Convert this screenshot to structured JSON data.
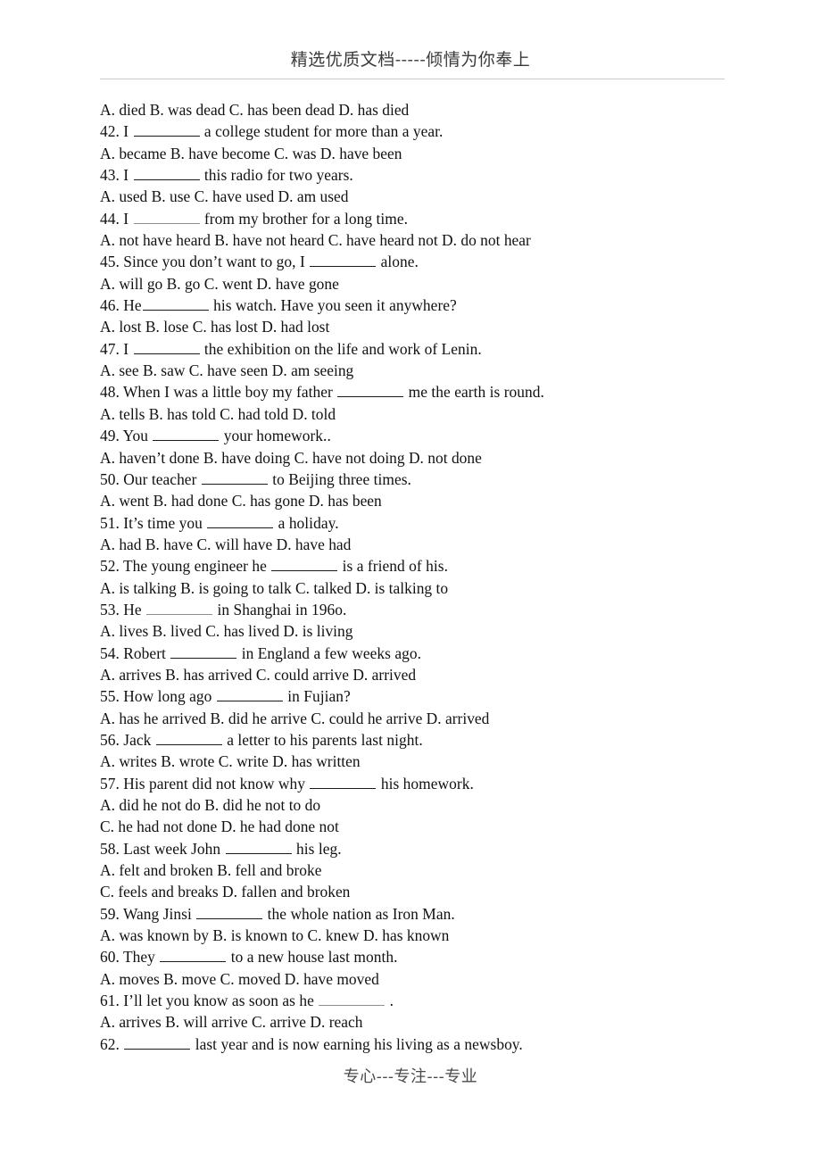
{
  "header": {
    "title": "精选优质文档-----倾情为你奉上",
    "rule_color": "#c9c9c9"
  },
  "footer": {
    "title": "专心---专注---专业"
  },
  "document": {
    "kind": "english-grammar-multiple-choice-worksheet",
    "page_text_color": "#111111",
    "lines": [
      {
        "id": "q41-options",
        "kind": "options",
        "text": "A. died    B. was dead    C. has been dead    D. has died"
      },
      {
        "id": "q42-stem",
        "kind": "stem",
        "pre": "42. I ",
        "post": " a college student for more than a year.",
        "blank": "w-std"
      },
      {
        "id": "q42-options",
        "kind": "options",
        "text": "A. became    B. have become    C. was    D. have been"
      },
      {
        "id": "q43-stem",
        "kind": "stem",
        "pre": "43. I ",
        "post": " this radio for two years.",
        "blank": "w-std"
      },
      {
        "id": "q43-options",
        "kind": "options",
        "text": "A. used   B. use   C. have used   D. am used"
      },
      {
        "id": "q44-stem",
        "kind": "stem",
        "pre": "44. I ",
        "post": " from my brother for a long time.",
        "blank": "w-faint"
      },
      {
        "id": "q44-options",
        "kind": "options",
        "text": "A. not have heard    B. have not heard    C. have heard not    D. do not hear"
      },
      {
        "id": "q45-stem",
        "kind": "stem",
        "pre": "45. Since you don’t want to go, I ",
        "post": " alone.",
        "blank": "w-std"
      },
      {
        "id": "q45-options",
        "kind": "options",
        "text": "A. will go   B. go   C. went   D. have gone"
      },
      {
        "id": "q46-stem",
        "kind": "stem",
        "pre": "46. He",
        "post": " his watch. Have you seen it anywhere?",
        "blank": "w-std"
      },
      {
        "id": "q46-options",
        "kind": "options",
        "text": "A. lost   B. lose   C. has lost   D. had lost"
      },
      {
        "id": "q47-stem",
        "kind": "stem",
        "pre": "47. I ",
        "post": " the exhibition on the life and work of Lenin.",
        "blank": "w-std"
      },
      {
        "id": "q47-options",
        "kind": "options",
        "text": "A. see   B. saw   C. have seen   D. am seeing"
      },
      {
        "id": "q48-stem",
        "kind": "stem",
        "pre": "48. When I was a little boy my father ",
        "post": " me the earth is round.",
        "blank": "w-std"
      },
      {
        "id": "q48-options",
        "kind": "options",
        "text": "A. tells   B. has told   C. had told   D. told"
      },
      {
        "id": "q49-stem",
        "kind": "stem",
        "pre": "49. You ",
        "post": " your homework..",
        "blank": "w-std"
      },
      {
        "id": "q49-options",
        "kind": "options",
        "text": "A. haven’t done   B. have doing   C. have not doing   D. not done"
      },
      {
        "id": "q50-stem",
        "kind": "stem",
        "pre": "50. Our teacher ",
        "post": " to Beijing three times.",
        "blank": "w-std"
      },
      {
        "id": "q50-options",
        "kind": "options",
        "text": "A. went   B. had done   C. has gone   D. has been"
      },
      {
        "id": "q51-stem",
        "kind": "stem",
        "pre": "51. It’s time you ",
        "post": " a holiday.",
        "blank": "w-std"
      },
      {
        "id": "q51-options",
        "kind": "options",
        "text": "A. had    B. have    C. will have    D. have had"
      },
      {
        "id": "q52-stem",
        "kind": "stem",
        "pre": "52. The young engineer he ",
        "post": " is a friend of his.",
        "blank": "w-std"
      },
      {
        "id": "q52-options",
        "kind": "options",
        "text": "A. is talking    B. is going to talk    C. talked    D. is talking to"
      },
      {
        "id": "q53-stem",
        "kind": "stem",
        "pre": "53. He ",
        "post": " in Shanghai in 196o.",
        "blank": "w-faint"
      },
      {
        "id": "q53-options",
        "kind": "options",
        "text": "A. lives   B. lived   C. has lived   D. is living"
      },
      {
        "id": "q54-stem",
        "kind": "stem",
        "pre": "54. Robert ",
        "post": " in England a few weeks ago.",
        "blank": "w-std"
      },
      {
        "id": "q54-options",
        "kind": "options",
        "text": "A. arrives    B. has arrived    C. could arrive    D. arrived"
      },
      {
        "id": "q55-stem",
        "kind": "stem",
        "pre": "55. How long ago ",
        "post": " in Fujian?",
        "blank": "w-std"
      },
      {
        "id": "q55-options",
        "kind": "options",
        "text": "A. has he arrived    B. did he arrive    C. could he arrive    D. arrived"
      },
      {
        "id": "q56-stem",
        "kind": "stem",
        "pre": "56. Jack ",
        "post": " a letter to his parents last night.",
        "blank": "w-std"
      },
      {
        "id": "q56-options",
        "kind": "options",
        "text": "A. writes   B. wrote   C. write   D. has written"
      },
      {
        "id": "q57-stem",
        "kind": "stem",
        "pre": "57. His parent did not know why ",
        "post": " his homework.",
        "blank": "w-std"
      },
      {
        "id": "q57-options-ab",
        "kind": "options",
        "text": "A. did he not do    B. did he not to do"
      },
      {
        "id": "q57-options-cd",
        "kind": "options",
        "text": "C. he had not done   D. he had done not"
      },
      {
        "id": "q58-stem",
        "kind": "stem",
        "pre": "58. Last week John ",
        "post": " his leg.",
        "blank": "w-std"
      },
      {
        "id": "q58-options-ab",
        "kind": "options",
        "text": "A. felt and broken    B. fell and broke"
      },
      {
        "id": "q58-options-cd",
        "kind": "options",
        "text": "C. feels and breaks   D. fallen and broken"
      },
      {
        "id": "q59-stem",
        "kind": "stem",
        "pre": "59. Wang Jinsi ",
        "post": " the whole nation as Iron Man.",
        "blank": "w-std"
      },
      {
        "id": "q59-options",
        "kind": "options",
        "text": "A. was known by   B. is known to   C. knew   D. has known"
      },
      {
        "id": "q60-stem",
        "kind": "stem",
        "pre": "60. They ",
        "post": " to a new house last month.",
        "blank": "w-std"
      },
      {
        "id": "q60-options",
        "kind": "options",
        "text": "A. moves   B. move   C. moved   D. have moved"
      },
      {
        "id": "q61-stem",
        "kind": "stem",
        "pre": "61. I’ll let you know as soon as he ",
        "post": " .",
        "blank": "w-faint"
      },
      {
        "id": "q61-options",
        "kind": "options",
        "text": "A. arrives   B. will arrive   C. arrive   D. reach"
      },
      {
        "id": "q62-stem",
        "kind": "stem",
        "pre": "62. ",
        "post": " last year and is now earning his living as a newsboy.",
        "blank": "w-std"
      }
    ]
  }
}
